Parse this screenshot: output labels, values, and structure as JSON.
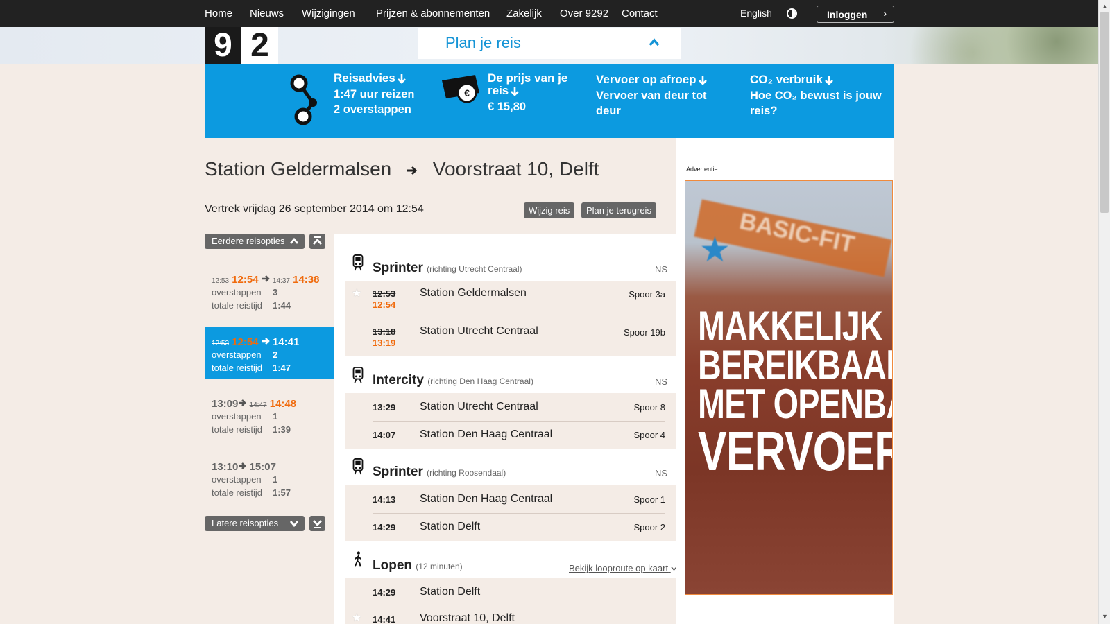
{
  "nav": {
    "items": [
      "Home",
      "Nieuws",
      "Wijzigingen",
      "Prijzen & abonnementen",
      "Zakelijk",
      "Over 9292",
      "Contact"
    ],
    "english": "English",
    "login": "Inloggen"
  },
  "logo": {
    "digits": [
      "9",
      "2",
      "9",
      "2"
    ]
  },
  "plan": {
    "title": "Plan je reis"
  },
  "summary": {
    "reisadvies": {
      "title": "Reisadvies",
      "line1": "1:47 uur reizen",
      "line2": "2 overstappen"
    },
    "prijs": {
      "title": "De prijs van je reis",
      "value": "€ 15,80"
    },
    "vervoer": {
      "title": "Vervoer op afroep",
      "text": "Vervoer van deur tot deur"
    },
    "co2": {
      "title": "CO₂ verbruik",
      "text": "Hoe CO₂ bewust is jouw reis?"
    }
  },
  "route": {
    "from": "Station Geldermalsen",
    "to": "Voorstraat 10, Delft"
  },
  "vertrek": "Vertrek vrijdag 26 september 2014 om 12:54",
  "buttons": {
    "wijzig": "Wijzig reis",
    "terugreis": "Plan je terugreis",
    "eerder": "Eerdere reisopties",
    "later": "Latere reisopties"
  },
  "options": [
    {
      "dep_planned": "12:53",
      "dep": "12:54",
      "arr_planned": "14:37",
      "arr": "14:38",
      "transfers_label": "overstappen",
      "transfers": "3",
      "duration_label": "totale reistijd",
      "duration": "1:44"
    },
    {
      "dep_planned": "12:53",
      "dep": "12:54",
      "arr_planned": "",
      "arr": "14:41",
      "transfers_label": "overstappen",
      "transfers": "2",
      "duration_label": "totale reistijd",
      "duration": "1:47"
    },
    {
      "dep_planned": "",
      "dep": "13:09",
      "arr_planned": "14:47",
      "arr": "14:48",
      "transfers_label": "overstappen",
      "transfers": "1",
      "duration_label": "totale reistijd",
      "duration": "1:39"
    },
    {
      "dep_planned": "",
      "dep": "13:10",
      "arr_planned": "",
      "arr": "15:07",
      "transfers_label": "overstappen",
      "transfers": "1",
      "duration_label": "totale reistijd",
      "duration": "1:57"
    }
  ],
  "legs": [
    {
      "type": "Sprinter",
      "direction": "(richting Utrecht Centraal)",
      "operator": "NS",
      "stops": [
        {
          "time": "12:53",
          "time_new": "12:54",
          "name": "Station Geldermalsen",
          "spoor": "Spoor 3a"
        },
        {
          "time": "13:18",
          "time_new": "13:19",
          "name": "Station Utrecht Centraal",
          "spoor": "Spoor 19b"
        }
      ]
    },
    {
      "type": "Intercity",
      "direction": "(richting Den Haag Centraal)",
      "operator": "NS",
      "stops": [
        {
          "time": "13:29",
          "name": "Station Utrecht Centraal",
          "spoor": "Spoor 8"
        },
        {
          "time": "14:07",
          "name": "Station Den Haag Centraal",
          "spoor": "Spoor 4"
        }
      ]
    },
    {
      "type": "Sprinter",
      "direction": "(richting Roosendaal)",
      "operator": "NS",
      "stops": [
        {
          "time": "14:13",
          "name": "Station Den Haag Centraal",
          "spoor": "Spoor 1"
        },
        {
          "time": "14:29",
          "name": "Station Delft",
          "spoor": "Spoor 2"
        }
      ]
    },
    {
      "type": "Lopen",
      "direction": "(12 minuten)",
      "map_link": "Bekijk looproute op kaart",
      "stops": [
        {
          "time": "14:29",
          "name": "Station Delft"
        },
        {
          "time": "14:41",
          "name": "Voorstraat 10, Delft"
        }
      ]
    }
  ],
  "ad": {
    "label": "Advertentie",
    "brand": "BASIC-FIT",
    "slogan": [
      "MAKKELIJK",
      "BEREIKBAAR",
      "MET OPENBAAR",
      "VERVOER"
    ]
  },
  "colors": {
    "blue": "#0c9ae0",
    "orange": "#f06a0c",
    "dark": "#222222",
    "page": "#f4ece6"
  }
}
